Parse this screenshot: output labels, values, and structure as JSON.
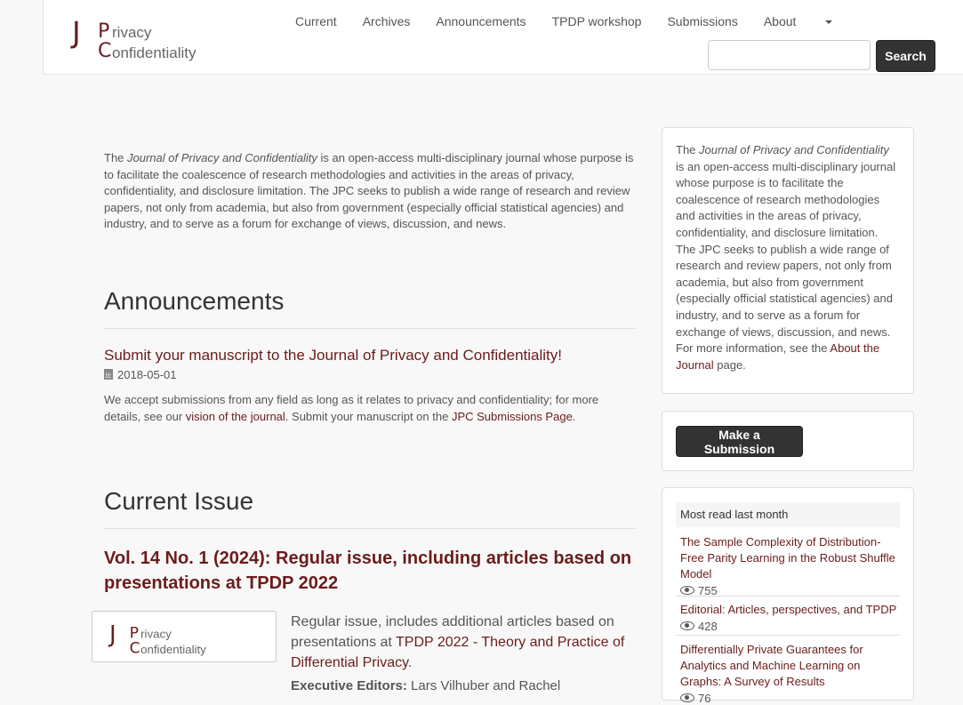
{
  "header": {
    "logo_letters": {
      "j": "J",
      "p": "P",
      "rivacy": "rivacy",
      "c": "C",
      "onfidentiality": "onfidentiality"
    },
    "nav": [
      "Current",
      "Archives",
      "Announcements",
      "TPDP workshop",
      "Submissions",
      "About"
    ],
    "search_placeholder": "",
    "search_button": "Search"
  },
  "main": {
    "intro": {
      "pre": "The ",
      "journal_name": "Journal of Privacy and Confidentiality",
      "post": " is an open-access multi-disciplinary journal whose purpose is to facilitate the coalescence of research methodologies and activities in the areas of privacy, confidentiality, and disclosure limitation. The JPC seeks to publish a wide range of research and review papers, not only from academia, but also from government (especially official statistical agencies) and industry, and to serve as a forum for exchange of views, discussion, and news."
    },
    "announcements": {
      "heading": "Announcements",
      "title": "Submit your manuscript to the Journal of Privacy and Confidentiality!",
      "date": "2018-05-01",
      "text_1": "We accept submissions from any field as long as it relates to privacy and confidentiality; for more details, see our ",
      "link_1": "vision of the journal",
      "text_2": ".  Submit your manuscript on the ",
      "link_2": "JPC Submissions Page",
      "text_3": "."
    },
    "current_issue": {
      "heading": "Current Issue",
      "title": "Vol. 14 No. 1 (2024): Regular issue, including articles based on presentations at TPDP 2022",
      "desc_pre": "Regular issue, includes additional articles based on presentations at ",
      "desc_link": "TPDP 2022 - Theory and Practice of Differential Privacy",
      "desc_post": ".",
      "editors_label": "Executive Editors:",
      "editors_text": " Lars Vilhuber and Rachel"
    }
  },
  "sidebar": {
    "about": {
      "pre": "The ",
      "journal_name": "Journal of Privacy and Confidentiality",
      "body": " is an open-access multi-disciplinary journal whose purpose is to facilitate the coalescence of research methodologies and activities in the areas of privacy, confidentiality, and disclosure limitation. The JPC seeks to publish a wide range of research and review papers, not only from academia, but also from government (especially official statistical agencies) and industry, and to serve as a forum for exchange of views, discussion, and news. For more information, see the ",
      "link": "About the Journal",
      "post": " page."
    },
    "submit_button": "Make a Submission",
    "most_read": {
      "heading": "Most read last month",
      "items": [
        {
          "title": "The Sample Complexity of Distribution-Free Parity Learning in the Robust Shuffle Model",
          "views": "755"
        },
        {
          "title": "Editorial: Articles, perspectives, and TPDP",
          "views": "428"
        },
        {
          "title": "Differentially Private Guarantees for Analytics and Machine Learning on Graphs: A Survey of Results",
          "views": "76"
        }
      ]
    }
  },
  "colors": {
    "brand": "#6b1c1c",
    "button": "#333333",
    "background": "#f8f8f8"
  }
}
